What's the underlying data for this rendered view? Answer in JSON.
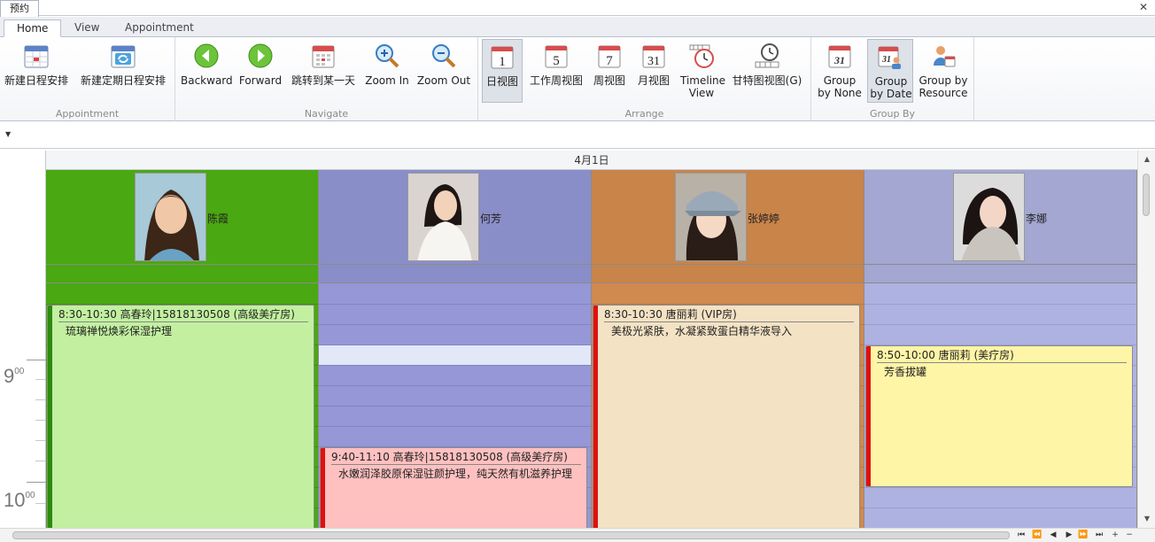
{
  "window": {
    "doc_tab": "预约",
    "close_glyph": "✕"
  },
  "ribbon_tabs": [
    {
      "label": "Home",
      "active": true
    },
    {
      "label": "View",
      "active": false
    },
    {
      "label": "Appointment",
      "active": false
    }
  ],
  "groups": {
    "appointment": {
      "label": "Appointment",
      "new_appointment": "新建日程安排",
      "new_recurring": "新建定期日程安排"
    },
    "navigate": {
      "label": "Navigate",
      "backward": "Backward",
      "forward": "Forward",
      "goto_date": "跳转到某一天",
      "zoom_in": "Zoom In",
      "zoom_out": "Zoom Out"
    },
    "arrange": {
      "label": "Arrange",
      "day_view": "日视图",
      "day_icon_num": "1",
      "work_week_view": "工作周视图",
      "work_week_icon_num": "5",
      "week_view": "周视图",
      "week_icon_num": "7",
      "month_view": "月视图",
      "month_icon_num": "31",
      "timeline_view": "Timeline View",
      "gantt_view": "甘特图视图(G)"
    },
    "group_by": {
      "label": "Group By",
      "none": "Group by None",
      "none_icon_num": "31",
      "date": "Group by Date",
      "date_icon_num": "31",
      "resource": "Group by Resource"
    }
  },
  "quick_access": {
    "dropdown_glyph": "▼"
  },
  "scheduler": {
    "date_header": "4月1日",
    "time_labels": [
      {
        "hour": "9",
        "minute": "00"
      },
      {
        "hour": "10",
        "minute": "00"
      }
    ],
    "resources": [
      {
        "name": "陈霞",
        "head_color": "#4aa812",
        "work_color": "#4aa812",
        "line_color": "#3d8f0f"
      },
      {
        "name": "何芳",
        "head_color": "#8a8ec8",
        "work_color": "#9597d6",
        "line_color": "#8185c4"
      },
      {
        "name": "张婷婷",
        "head_color": "#c98449",
        "work_color": "#d0894e",
        "line_color": "#b87a43"
      },
      {
        "name": "李娜",
        "head_color": "#a3a7d1",
        "work_color": "#aeb2e1",
        "line_color": "#9a9ecf"
      }
    ],
    "appointments": [
      {
        "resource": 0,
        "title": "8:30-10:30 高春玲|15818130508 (高级美疗房)",
        "description": "琉璃禅悦焕彩保湿护理",
        "bg": "#c2f0a0",
        "bar": "#2e8b10"
      },
      {
        "resource": 1,
        "title": "9:40-11:10 高春玲|15818130508 (高级美疗房)",
        "description": "水嫩润泽胶原保湿驻颜护理，纯天然有机滋养护理",
        "bg": "#ffc0c0",
        "bar": "#e01010"
      },
      {
        "resource": 2,
        "title": "8:30-10:30 唐丽莉 (VIP房)",
        "description": "美极光紧肤，水凝紧致蛋白精华液导入",
        "bg": "#f4e2c4",
        "bar": "#e01010"
      },
      {
        "resource": 3,
        "title": "8:50-10:00 唐丽莉 (美疗房)",
        "description": "芳香拔罐",
        "bg": "#fff5a6",
        "bar": "#e01010"
      }
    ]
  },
  "bottom_nav": [
    "⏮",
    "⏪",
    "◀",
    "▶",
    "⏩",
    "⏭",
    "+",
    "−"
  ],
  "scroll_glyphs": {
    "up": "▲",
    "down": "▼"
  }
}
